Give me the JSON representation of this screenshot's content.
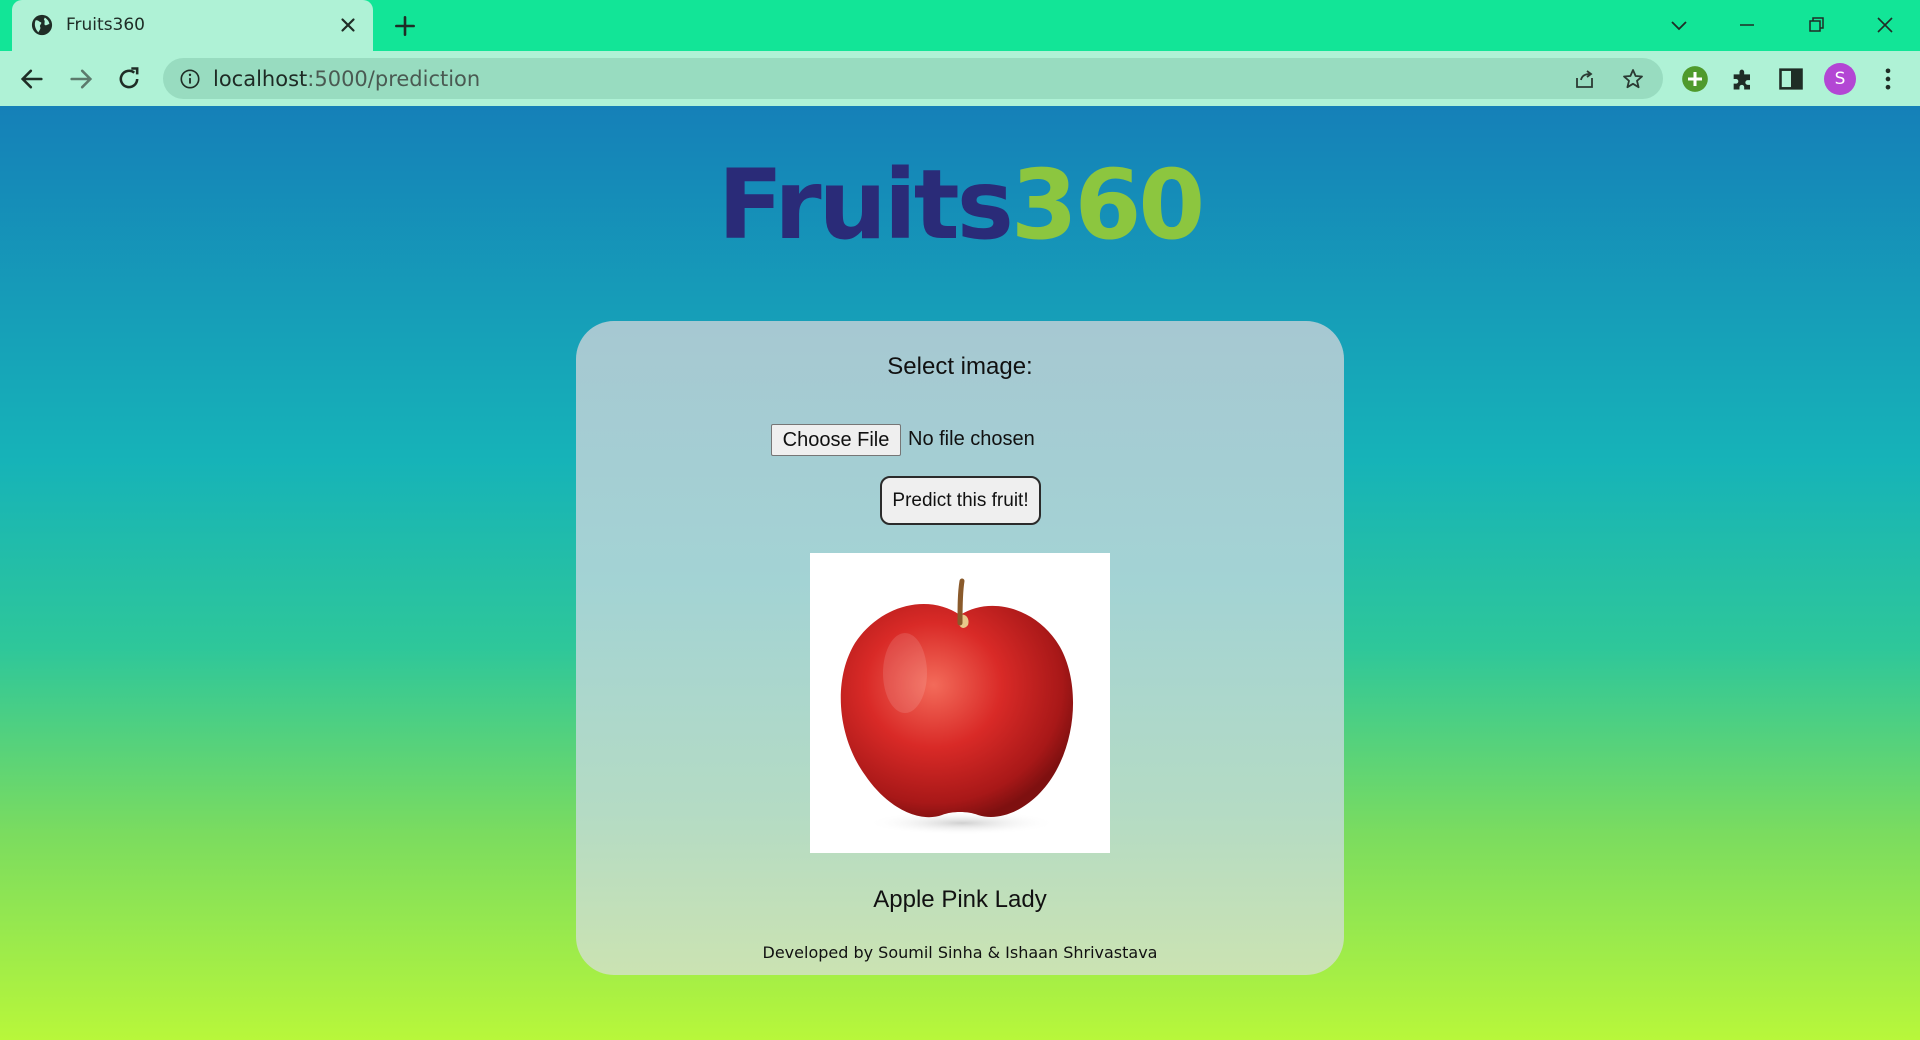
{
  "browser": {
    "tab": {
      "title": "Fruits360"
    },
    "address_bar": {
      "host": "localhost",
      "path": ":5000/prediction"
    },
    "profile_initial": "S"
  },
  "page": {
    "logo": {
      "part1": "Fruits",
      "part2": "360"
    },
    "form": {
      "select_label": "Select image:",
      "choose_file_label": "Choose File",
      "file_status": "No file chosen",
      "predict_button": "Predict this fruit!"
    },
    "prediction": "Apple Pink Lady",
    "footer": "Developed by Soumil Sinha & Ishaan Shrivastava"
  },
  "colors": {
    "tabstrip": "#12e597",
    "toolbar": "#aff2d6",
    "logo_primary": "#2a2b78",
    "logo_accent": "#8cc63f",
    "avatar": "#b346d4"
  }
}
